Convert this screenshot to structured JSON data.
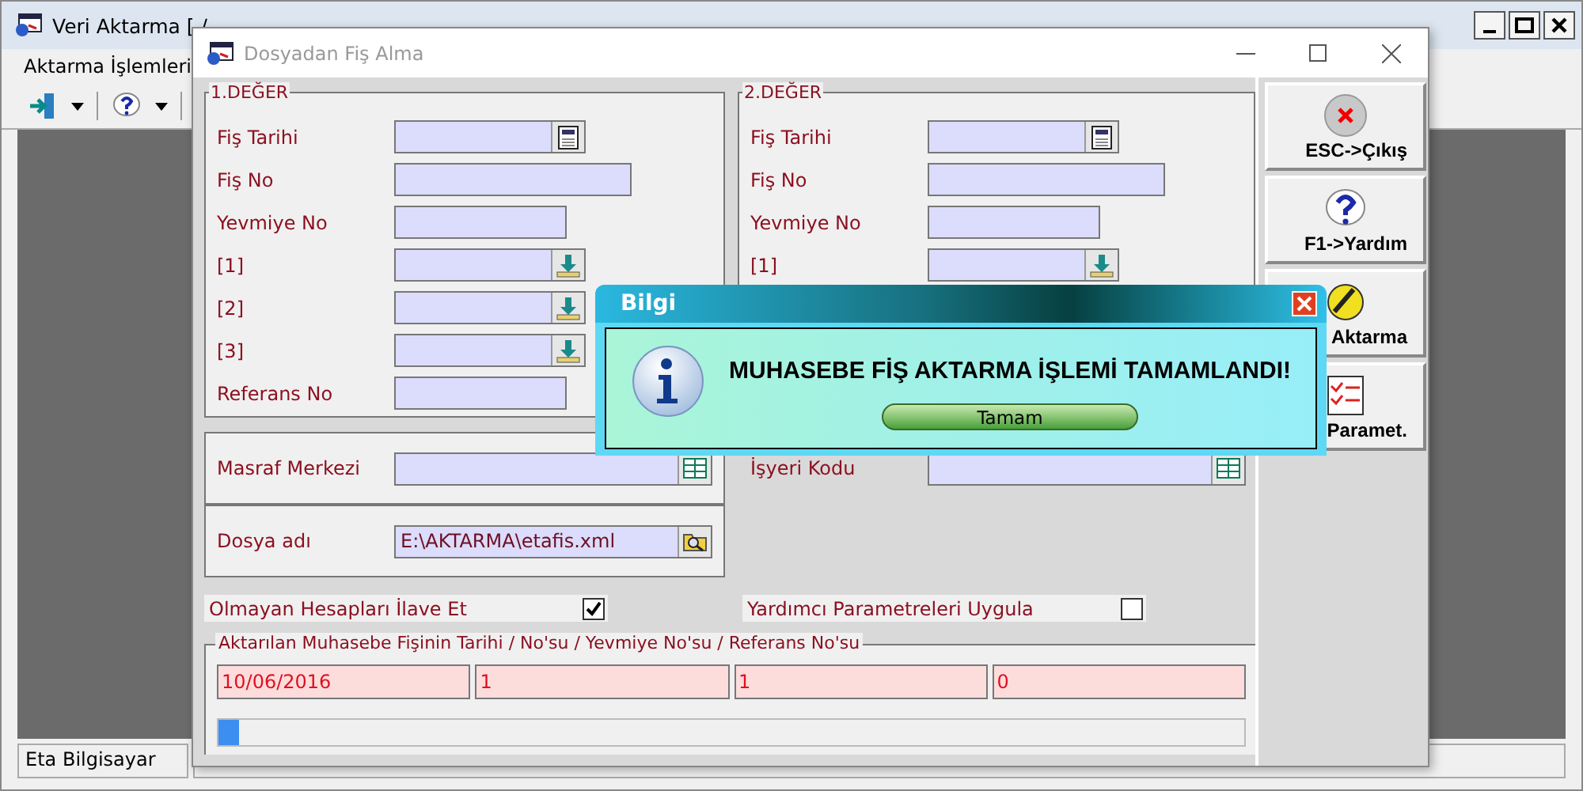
{
  "main_window": {
    "title": "Veri Aktarma [ /",
    "menu": [
      "Aktarma İşlemleri"
    ],
    "status_bar": [
      "Eta Bilgisayar"
    ]
  },
  "form_window": {
    "title": "Dosyadan Fiş Alma",
    "groups": [
      {
        "title": "1.DEĞER",
        "fields": [
          {
            "label": "Fiş Tarihi",
            "kind": "date"
          },
          {
            "label": "Fiş No",
            "kind": "text"
          },
          {
            "label": "Yevmiye No",
            "kind": "short"
          },
          {
            "label": "[1]",
            "kind": "lookup"
          },
          {
            "label": "[2]",
            "kind": "lookup"
          },
          {
            "label": "[3]",
            "kind": "lookup"
          },
          {
            "label": "Referans No",
            "kind": "short"
          }
        ]
      },
      {
        "title": "2.DEĞER",
        "fields": [
          {
            "label": "Fiş Tarihi",
            "kind": "date"
          },
          {
            "label": "Fiş No",
            "kind": "text"
          },
          {
            "label": "Yevmiye No",
            "kind": "short"
          },
          {
            "label": "[1]",
            "kind": "lookup"
          }
        ]
      }
    ],
    "cost_center": {
      "label": "Masraf Merkezi"
    },
    "workplace": {
      "label": "İşyeri Kodu"
    },
    "file": {
      "label": "Dosya adı",
      "value": "E:\\AKTARMA\\etafis.xml"
    },
    "options": [
      {
        "label": "Olmayan Hesapları İlave Et",
        "checked": true
      },
      {
        "label": "Yardımcı Parametreleri Uygula",
        "checked": false
      }
    ],
    "result": {
      "title": "Aktarılan Muhasebe Fişinin Tarihi / No'su / Yevmiye No'su / Referans No'su",
      "cells": [
        "10/06/2016",
        "1",
        "1",
        "0"
      ],
      "progress": {
        "level": 0.02
      }
    },
    "buttons": [
      {
        "label": "ESC->Çıkış",
        "kind": "exit"
      },
      {
        "label": "F1->Yardım",
        "kind": "help"
      },
      {
        "label": "Aktarma",
        "kind": "transfer"
      },
      {
        "label": "Paramet.",
        "kind": "params"
      }
    ]
  },
  "message_box": {
    "title": "Bilgi",
    "message": "MUHASEBE FİŞ AKTARMA İŞLEMİ TAMAMLANDI!",
    "button": "Tamam"
  }
}
